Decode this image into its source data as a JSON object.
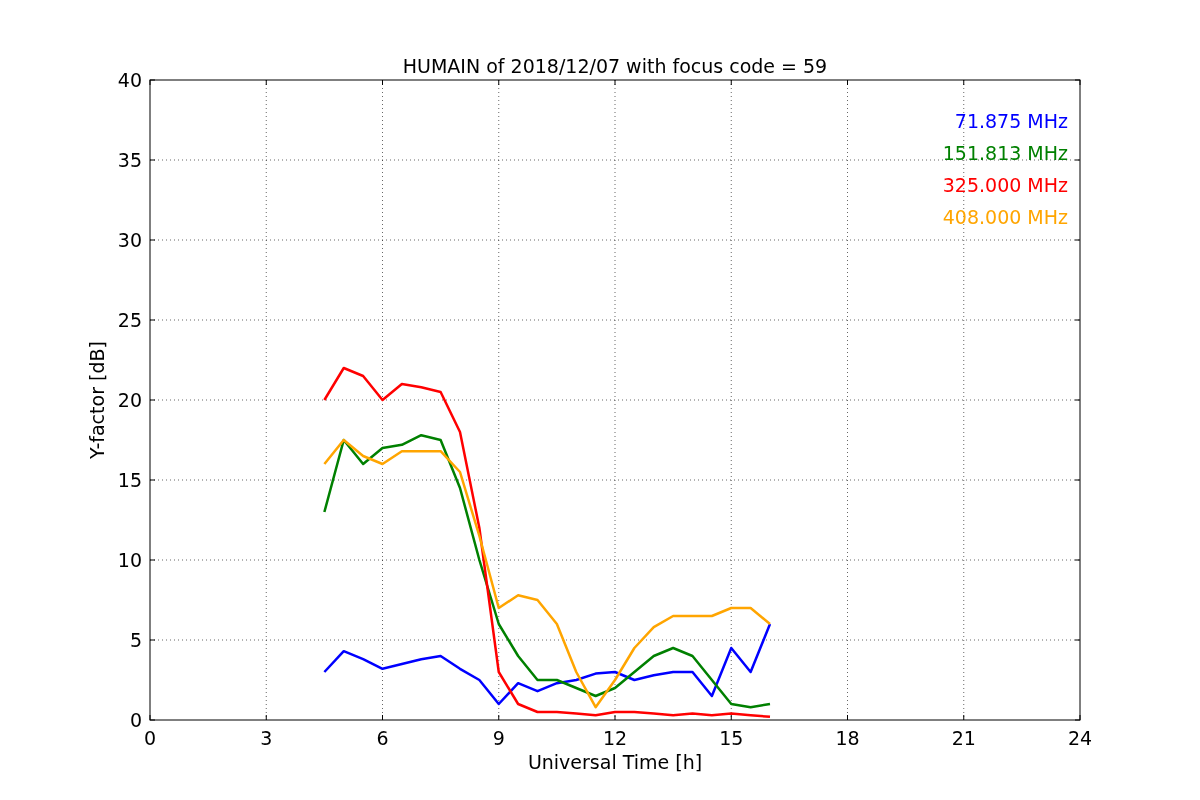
{
  "chart_data": {
    "type": "line",
    "title": "HUMAIN of 2018/12/07 with focus code = 59",
    "xlabel": "Universal Time [h]",
    "ylabel": "Y-factor [dB]",
    "x": [
      4.5,
      5,
      5.5,
      6,
      6.5,
      7,
      7.5,
      8,
      8.5,
      9,
      9.5,
      10,
      10.5,
      11,
      11.5,
      12,
      12.5,
      13,
      13.5,
      14,
      14.5,
      15,
      15.5,
      16
    ],
    "series": [
      {
        "name": "71.875 MHz",
        "color": "#0000ff",
        "values": [
          3,
          4.3,
          3.8,
          3.2,
          3.5,
          3.8,
          4,
          3.2,
          2.5,
          1,
          2.3,
          1.8,
          2.3,
          2.5,
          2.9,
          3,
          2.5,
          2.8,
          3,
          3,
          1.5,
          4.5,
          3,
          6
        ]
      },
      {
        "name": "151.813 MHz",
        "color": "#008000",
        "values": [
          13,
          17.5,
          16,
          17,
          17.2,
          17.8,
          17.5,
          14.5,
          10,
          6,
          4,
          2.5,
          2.5,
          2,
          1.5,
          2,
          3,
          4,
          4.5,
          4,
          2.5,
          1,
          0.8,
          1
        ]
      },
      {
        "name": "325.000 MHz",
        "color": "#ff0000",
        "values": [
          20,
          22,
          21.5,
          20,
          21,
          20.8,
          20.5,
          18,
          12,
          3,
          1,
          0.5,
          0.5,
          0.4,
          0.3,
          0.5,
          0.5,
          0.4,
          0.3,
          0.4,
          0.3,
          0.4,
          0.3,
          0.2
        ]
      },
      {
        "name": "408.000 MHz",
        "color": "#ffa500",
        "values": [
          16,
          17.5,
          16.5,
          16,
          16.8,
          16.8,
          16.8,
          15.5,
          11.5,
          7,
          7.8,
          7.5,
          6,
          3,
          0.8,
          2.5,
          4.5,
          5.8,
          6.5,
          6.5,
          6.5,
          7,
          7,
          6
        ]
      }
    ],
    "xlim": [
      0,
      24
    ],
    "ylim": [
      0,
      40
    ],
    "xticks": [
      0,
      3,
      6,
      9,
      12,
      15,
      18,
      21,
      24
    ],
    "yticks": [
      0,
      5,
      10,
      15,
      20,
      25,
      30,
      35,
      40
    ],
    "grid": true
  }
}
